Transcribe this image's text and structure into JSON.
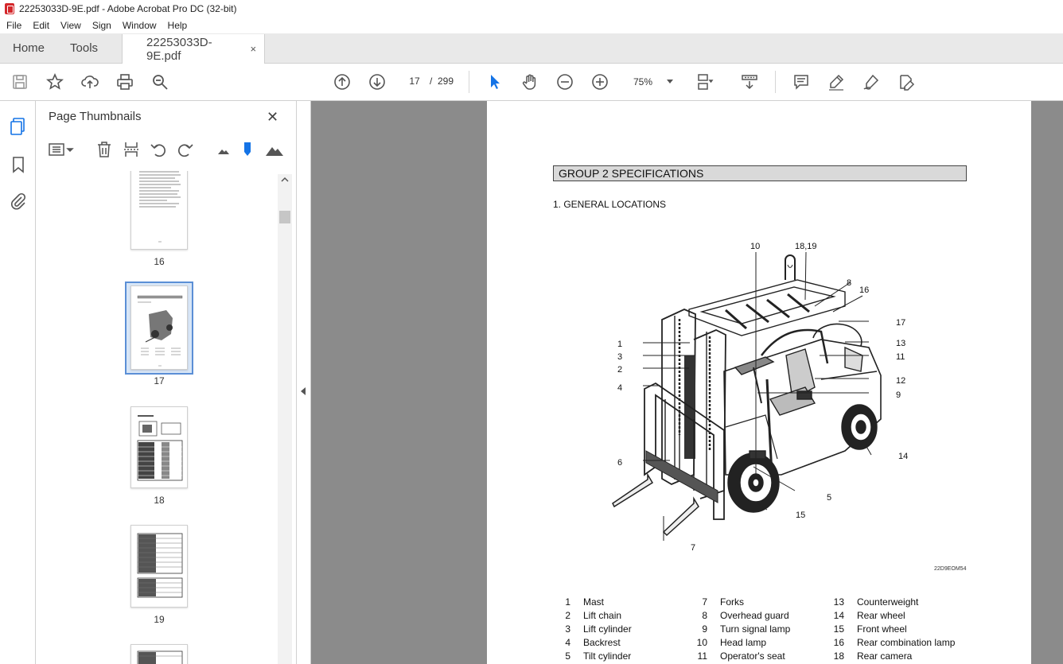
{
  "window": {
    "title": "22253033D-9E.pdf - Adobe Acrobat Pro DC (32-bit)"
  },
  "menu": [
    "File",
    "Edit",
    "View",
    "Sign",
    "Window",
    "Help"
  ],
  "tabs": {
    "home": "Home",
    "tools": "Tools",
    "document": "22253033D-9E.pdf",
    "close_glyph": "×"
  },
  "toolbar": {
    "current_page": "17",
    "separator": "/",
    "page_count": "299",
    "zoom": "75%"
  },
  "panel": {
    "title": "Page Thumbnails",
    "close_glyph": "✕",
    "thumbnails": [
      {
        "label": "16"
      },
      {
        "label": "17",
        "selected": true
      },
      {
        "label": "18"
      },
      {
        "label": "19"
      }
    ]
  },
  "document": {
    "group_heading": "GROUP 2  SPECIFICATIONS",
    "section_heading": "1. GENERAL LOCATIONS",
    "figure_code": "22D9EOM54",
    "callouts": [
      "10",
      "18,19",
      "8",
      "16",
      "17",
      "1",
      "3",
      "2",
      "13",
      "11",
      "12",
      "4",
      "9",
      "6",
      "14",
      "5",
      "15",
      "7"
    ],
    "legend_col1": [
      {
        "n": "1",
        "label": "Mast"
      },
      {
        "n": "2",
        "label": "Lift chain"
      },
      {
        "n": "3",
        "label": "Lift cylinder"
      },
      {
        "n": "4",
        "label": "Backrest"
      },
      {
        "n": "5",
        "label": "Tilt cylinder"
      }
    ],
    "legend_col2": [
      {
        "n": "7",
        "label": "Forks"
      },
      {
        "n": "8",
        "label": "Overhead guard"
      },
      {
        "n": "9",
        "label": "Turn signal lamp"
      },
      {
        "n": "10",
        "label": "Head lamp"
      },
      {
        "n": "11",
        "label": "Operator's seat"
      }
    ],
    "legend_col3": [
      {
        "n": "13",
        "label": "Counterweight"
      },
      {
        "n": "14",
        "label": "Rear wheel"
      },
      {
        "n": "15",
        "label": "Front wheel"
      },
      {
        "n": "16",
        "label": "Rear combination lamp"
      },
      {
        "n": "18",
        "label": "Rear camera"
      }
    ]
  },
  "colors": {
    "accent": "#1473e6",
    "selection": "#5b8fd6",
    "viewer_bg": "#8b8b8b"
  }
}
